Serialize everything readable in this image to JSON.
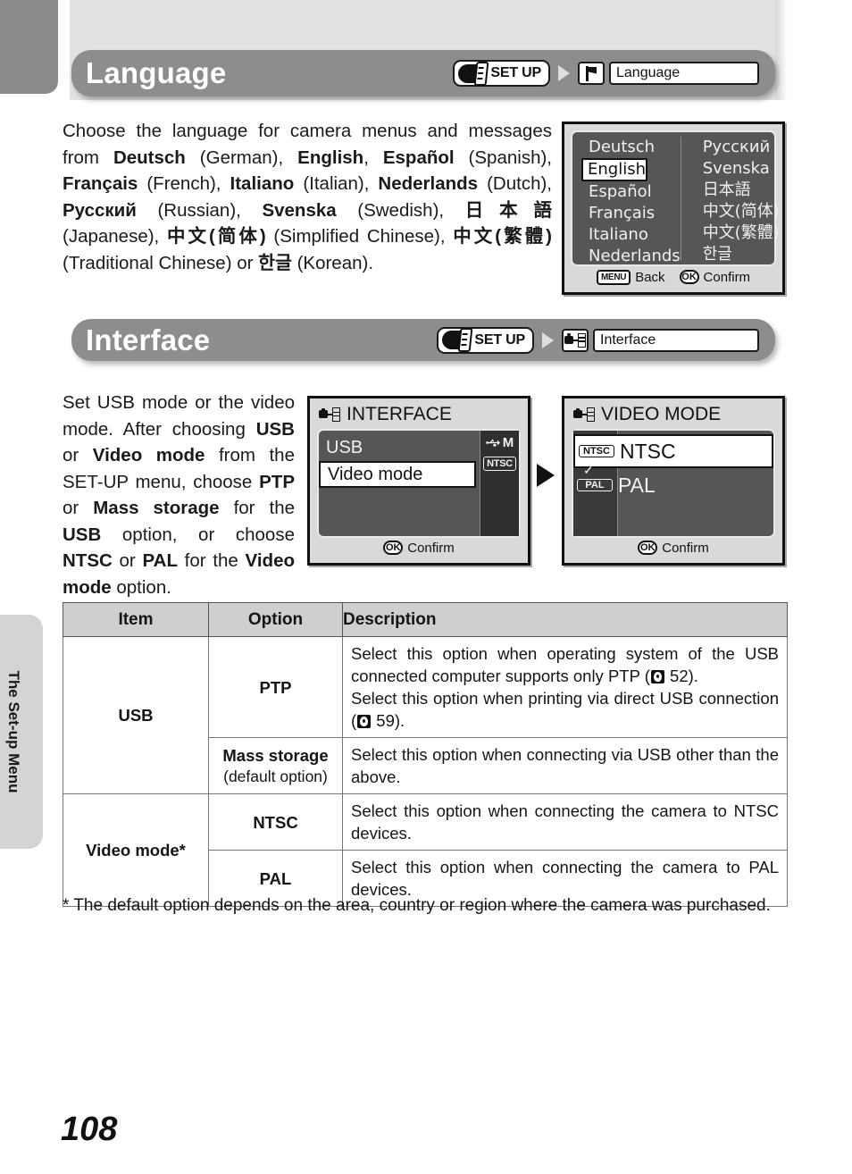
{
  "page": {
    "number": "108",
    "side_tab_label": "The Set-up Menu"
  },
  "language_section": {
    "title": "Language",
    "breadcrumb": {
      "setup_label": "SET UP",
      "menu_icon": "flag-icon",
      "menu_label": "Language"
    },
    "body_html": "Choose the language for camera menus and messages from <b>Deutsch</b> (German), <b>English</b>, <b>Español</b> (Spanish), <b>Français</b> (French), <b>Italiano</b> (Italian), <b>Nederlands</b> (Dutch), <b>Русский</b> (Russian), <b>Svenska</b> (Swedish), <b>日本語</b> (Japanese), <b>中文(简体)</b> (Simplified Chinese), <b>中文(繁體)</b> (Traditional Chinese) or <b>한글</b> (Korean).",
    "lcd": {
      "left_column": [
        "Deutsch",
        "English",
        "Español",
        "Français",
        "Italiano",
        "Nederlands"
      ],
      "right_column": [
        "Русский",
        "Svenska",
        "日本語",
        "中文(简体)",
        "中文(繁體)",
        "한글"
      ],
      "selected": "English",
      "checkmark": "✓",
      "footer": {
        "back_button": "MENU",
        "back_label": "Back",
        "confirm_button": "OK",
        "confirm_label": "Confirm"
      }
    }
  },
  "interface_section": {
    "title": "Interface",
    "breadcrumb": {
      "setup_label": "SET UP",
      "menu_icon": "camera-device-icon",
      "menu_label": "Interface"
    },
    "body_html": "Set USB mode or the video mode. After choosing <b>USB</b> or <b>Video mode</b> from the SET-UP menu, choose <b>PTP</b> or <b>Mass storage</b> for the <b>USB</b> option, or choose <b>NTSC</b> or <b>PAL</b> for the <b>Video mode</b> option.",
    "interface_lcd": {
      "title": "INTERFACE",
      "rows": [
        {
          "label": "USB",
          "selected": false,
          "badge": "USB-M"
        },
        {
          "label": "Video mode",
          "selected": true,
          "badge": "NTSC"
        }
      ],
      "confirm_button": "OK",
      "confirm_label": "Confirm"
    },
    "video_lcd": {
      "title": "VIDEO MODE",
      "rows": [
        {
          "label": "NTSC",
          "badge": "NTSC",
          "selected": true,
          "checked": true
        },
        {
          "label": "PAL",
          "badge": "PAL",
          "selected": false,
          "checked": false
        }
      ],
      "checkmark": "✓",
      "confirm_button": "OK",
      "confirm_label": "Confirm"
    }
  },
  "table": {
    "headers": [
      "Item",
      "Option",
      "Description"
    ],
    "rows": [
      {
        "item": "USB",
        "option": "PTP",
        "option_sub": "",
        "desc_html": "Select this option when operating system of the USB connected computer supports only PTP (<span class=\"bookmark\"></span> 52).<br>Select this option when printing via direct USB connection (<span class=\"bookmark\"></span> 59)."
      },
      {
        "item": "",
        "option": "Mass storage",
        "option_sub": "(default option)",
        "desc_html": "Select this option when connecting via USB other than the above."
      },
      {
        "item": "Video mode*",
        "option": "NTSC",
        "option_sub": "",
        "desc_html": "Select this option when connecting the camera to NTSC devices."
      },
      {
        "item": "",
        "option": "PAL",
        "option_sub": "",
        "desc_html": "Select this option when connecting the camera to PAL devices."
      }
    ]
  },
  "footnote": "* The default option depends on the area, country or region where the camera was purchased."
}
